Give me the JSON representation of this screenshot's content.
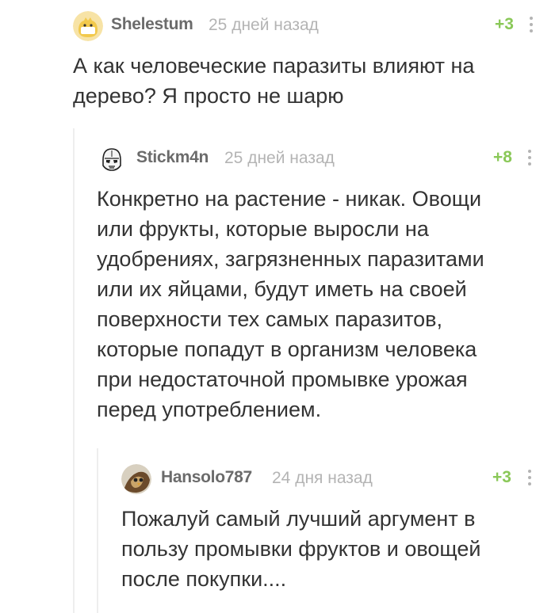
{
  "comments": [
    {
      "username": "Shelestum",
      "time": "25 дней назад",
      "rating": "+3",
      "avatar": "cat-avatar-icon",
      "text": "А как человеческие паразиты влияют на\nдерево? Я просто не шарю"
    },
    {
      "username": "Stickm4n",
      "time": "25 дней назад",
      "rating": "+8",
      "avatar": "stormtrooper-avatar-icon",
      "text": "Конкретно на растение - никак. Овощи\nили фрукты, которые выросли на\nудобрениях, загрязненных паразитами\nили их яйцами, будут иметь на своей\nповерхности тех самых паразитов,\nкоторые попадут в организм человека\nпри недостаточной промывке урожая\nперед употреблением."
    },
    {
      "username": "Hansolo787",
      "time": "24 дня назад",
      "rating": "+3",
      "avatar": "owl-avatar-icon",
      "text": "Пожалуй самый лучший аргумент в\nпользу промывки фруктов и овощей\nпосле покупки...."
    }
  ],
  "colors": {
    "rating": "#8ac858",
    "username": "#6b6b6b",
    "time": "#b4b4b4",
    "thread_line": "#eeeeee"
  }
}
